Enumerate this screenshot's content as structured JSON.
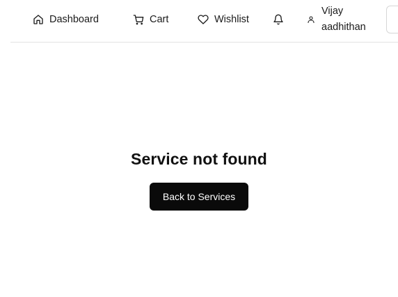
{
  "navbar": {
    "items": [
      {
        "label": "Dashboard",
        "icon": "home-icon"
      },
      {
        "label": "Cart",
        "icon": "cart-icon"
      },
      {
        "label": "Wishlist",
        "icon": "heart-icon"
      }
    ],
    "notification_icon": "bell-icon",
    "user": {
      "icon": "user-icon",
      "name_line1": "Vijay",
      "name_line2": "aadhithan"
    }
  },
  "main": {
    "title": "Service not found",
    "back_button_label": "Back to Services"
  },
  "colors": {
    "button_background": "#0a0a0a",
    "button_text": "#ffffff",
    "border": "#e2e2e2"
  }
}
